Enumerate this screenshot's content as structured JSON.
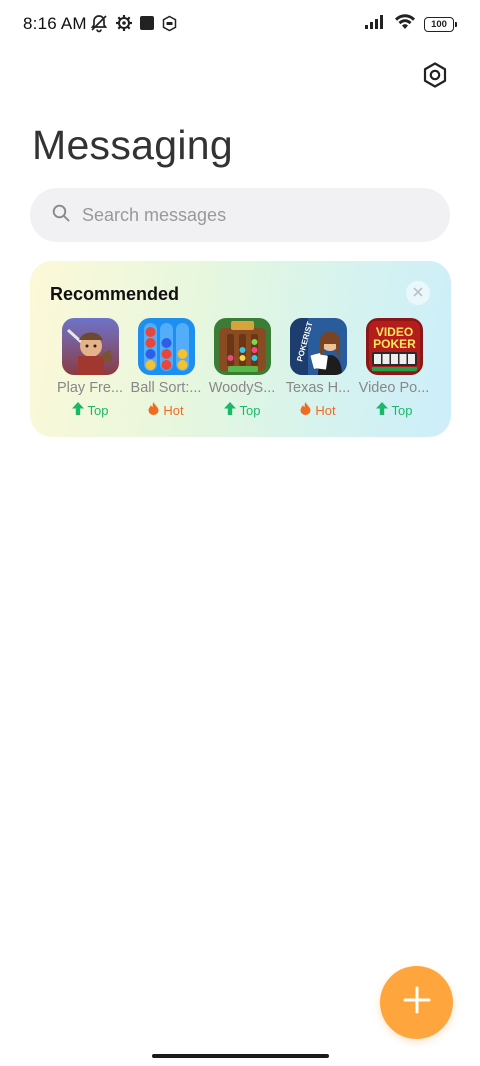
{
  "status_bar": {
    "time": "8:16 AM",
    "battery": "100",
    "icons_left": [
      "muted-bell-icon",
      "gear-icon",
      "square-icon",
      "shield-icon"
    ],
    "icons_right": [
      "signal-icon",
      "wifi-icon",
      "battery-icon"
    ]
  },
  "header": {
    "title": "Messaging",
    "settings_icon": "settings-hexagon-icon"
  },
  "search": {
    "placeholder": "Search messages"
  },
  "recommended": {
    "title": "Recommended",
    "apps": [
      {
        "name": "Play Fre...",
        "badge": "Top",
        "badge_type": "top"
      },
      {
        "name": "Ball Sort:...",
        "badge": "Hot",
        "badge_type": "hot"
      },
      {
        "name": "WoodyS...",
        "badge": "Top",
        "badge_type": "top"
      },
      {
        "name": "Texas H...",
        "badge": "Hot",
        "badge_type": "hot"
      },
      {
        "name": "Video Po...",
        "badge": "Top",
        "badge_type": "top"
      }
    ],
    "poker_label_1": "VIDEO",
    "poker_label_2": "POKER",
    "texas_label": "POKERIST"
  },
  "colors": {
    "fab": "#ffa53d",
    "badge_top": "#1cb86a",
    "badge_hot": "#f26a20"
  }
}
